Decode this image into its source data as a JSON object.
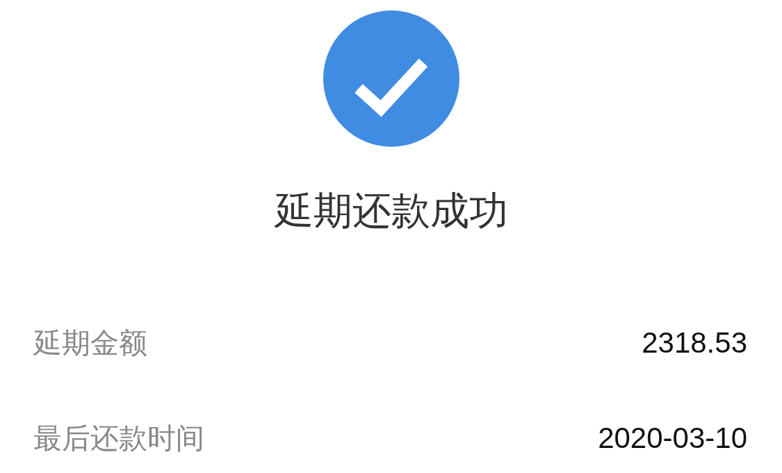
{
  "title": "延期还款成功",
  "details": [
    {
      "label": "延期金额",
      "value": "2318.53"
    },
    {
      "label": "最后还款时间",
      "value": "2020-03-10"
    }
  ]
}
